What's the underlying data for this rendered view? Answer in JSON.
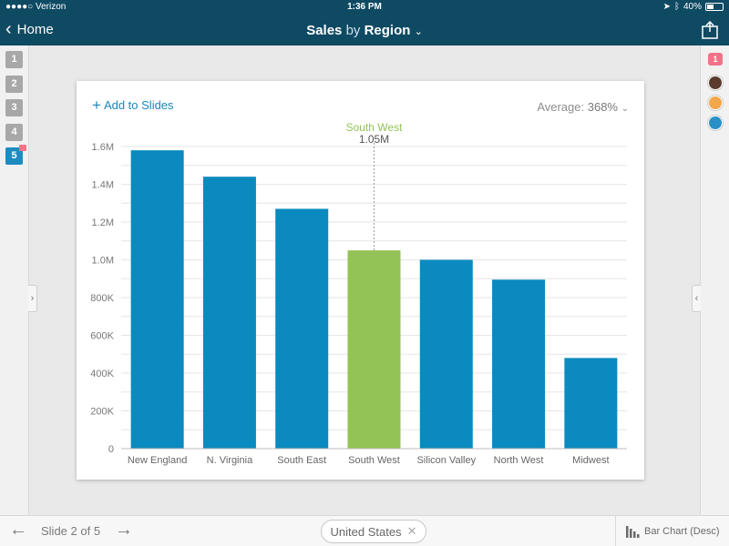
{
  "status": {
    "carrier": "●●●●○ Verizon",
    "time": "1:36 PM",
    "battery": "40%"
  },
  "nav": {
    "back_label": "Home",
    "title_part1": "Sales",
    "title_part2": "by",
    "title_part3": "Region"
  },
  "slides": {
    "numbers": [
      "1",
      "2",
      "3",
      "4",
      "5"
    ],
    "active": 4
  },
  "comments": {
    "count": "1"
  },
  "card": {
    "add_label": "Add to Slides",
    "avg_label": "Average:",
    "avg_value": "368%"
  },
  "tooltip": {
    "category": "South West",
    "value": "1.05M"
  },
  "bottom": {
    "slide_label": "Slide 2 of 5",
    "filter": "United States",
    "chart_type": "Bar Chart (Desc)"
  },
  "colors": {
    "bar": "#0a8abf",
    "highlight": "#93c356",
    "brand": "#0f4a63",
    "accent": "#1a87bb"
  },
  "chart_data": {
    "type": "bar",
    "categories": [
      "New England",
      "N. Virginia",
      "South East",
      "South West",
      "Silicon Valley",
      "North West",
      "Midwest"
    ],
    "values": [
      1580000,
      1440000,
      1270000,
      1050000,
      1000000,
      895000,
      480000
    ],
    "highlighted": "South West",
    "ylim": [
      0,
      1600000
    ],
    "yticks": [
      0,
      200000,
      400000,
      600000,
      800000,
      1000000,
      1200000,
      1400000,
      1600000
    ],
    "ytick_labels": [
      "0",
      "200K",
      "400K",
      "600K",
      "800K",
      "1.0M",
      "1.2M",
      "1.4M",
      "1.6M"
    ],
    "grid": true,
    "title": "",
    "xlabel": "",
    "ylabel": ""
  }
}
